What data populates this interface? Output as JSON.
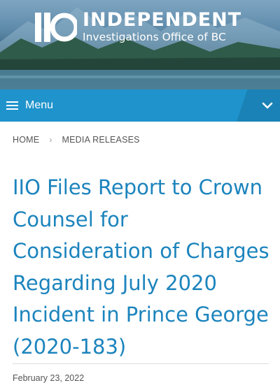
{
  "header": {
    "logo_mark": "IIO",
    "logo_line1": "INDEPENDENT",
    "logo_line2": "Investigations Office of BC"
  },
  "nav": {
    "menu_label": "Menu",
    "menu_icon": "hamburger-icon",
    "expand_icon": "chevron-down-icon"
  },
  "breadcrumb": {
    "items": [
      "HOME",
      "MEDIA RELEASES"
    ],
    "separator_icon": "chevron-right-icon"
  },
  "article": {
    "title": "IIO Files Report to Crown Counsel for Consideration of Charges Regarding July 2020 Incident in Prince George (2020-183)",
    "date": "February 23, 2022"
  },
  "colors": {
    "accent": "#1c84bd",
    "menubar": "#1f93cc"
  }
}
